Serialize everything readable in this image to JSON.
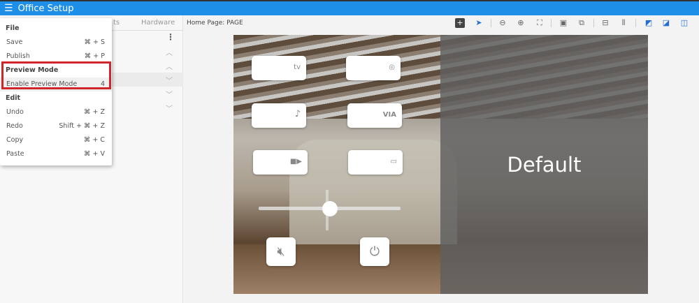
{
  "app": {
    "title": "Office Setup",
    "menu_icon": "hamburger-icon"
  },
  "sidebar": {
    "tabs": [
      "ts",
      "Hardware"
    ]
  },
  "main": {
    "header": "Home Page: PAGE",
    "default_label": "Default"
  },
  "toolbar": [
    "add-icon",
    "pointer-icon",
    "zoom-out-icon",
    "zoom-in-icon",
    "zoom-fit-icon",
    "frame-icon",
    "bring-forward-icon",
    "align-center-icon",
    "distribute-icon",
    "layer-back-icon",
    "layer-front-icon",
    "layout-icon"
  ],
  "canvas_buttons": [
    {
      "icon": "apple-tv-icon",
      "label": "tv"
    },
    {
      "icon": "chrome-icon"
    },
    {
      "icon": "music-note-icon",
      "label": "♪"
    },
    {
      "icon": "via-icon",
      "label": "VIA"
    },
    {
      "icon": "video-camera-icon"
    },
    {
      "icon": "game-icon"
    }
  ],
  "volume": {
    "level": 0.5
  },
  "menu": {
    "file": "File",
    "save": {
      "label": "Save",
      "shortcut": "⌘ + S"
    },
    "publish": {
      "label": "Publish",
      "shortcut": "⌘ + P"
    },
    "preview": "Preview Mode",
    "enable_preview": {
      "label": "Enable Preview Mode",
      "shortcut": "4"
    },
    "edit": "Edit",
    "undo": {
      "label": "Undo",
      "shortcut": "⌘ + Z"
    },
    "redo": {
      "label": "Redo",
      "shortcut": "Shift + ⌘ + Z"
    },
    "copy": {
      "label": "Copy",
      "shortcut": "⌘ + C"
    },
    "paste": {
      "label": "Paste",
      "shortcut": "⌘ + V"
    }
  }
}
